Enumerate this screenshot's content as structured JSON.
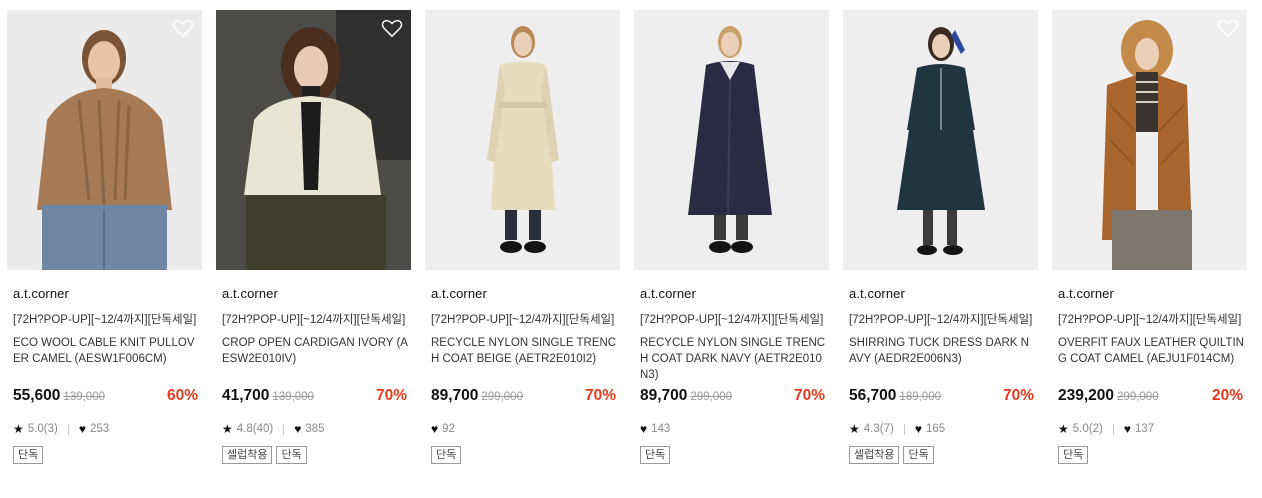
{
  "products": [
    {
      "brand": "a.t.corner",
      "tag": "[72H?POP-UP][~12/4까지][단독세일]",
      "name": "ECO WOOL CABLE KNIT PULLOVER CAMEL (AESW1F006CM)",
      "price": "55,600",
      "original_price": "139,000",
      "discount": "60%",
      "rating": "5.0(3)",
      "likes": "253",
      "badges": [
        "단독"
      ],
      "colors": {
        "bg": "#ededed",
        "main": "#a57a55",
        "bottom": "#6f86a2"
      }
    },
    {
      "brand": "a.t.corner",
      "tag": "[72H?POP-UP][~12/4까지][단독세일]",
      "name": "CROP OPEN CARDIGAN IVORY (AESW2E010IV)",
      "price": "41,700",
      "original_price": "139,000",
      "discount": "70%",
      "rating": "4.8(40)",
      "likes": "385",
      "badges": [
        "셀럽착용",
        "단독"
      ],
      "colors": {
        "bg": "#4a4a48",
        "main": "#e8e5d2",
        "bottom": "#42402e"
      }
    },
    {
      "brand": "a.t.corner",
      "tag": "[72H?POP-UP][~12/4까지][단독세일]",
      "name": "RECYCLE NYLON SINGLE TRENCH COAT BEIGE (AETR2E010I2)",
      "price": "89,700",
      "original_price": "299,000",
      "discount": "70%",
      "rating": "",
      "likes": "92",
      "badges": [
        "단독"
      ],
      "colors": {
        "bg": "#efefef",
        "main": "#e6dcbe",
        "bottom": "#2a2e3a"
      }
    },
    {
      "brand": "a.t.corner",
      "tag": "[72H?POP-UP][~12/4까지][단독세일]",
      "name": "RECYCLE NYLON SINGLE TRENCH COAT DARK NAVY (AETR2E010N3)",
      "price": "89,700",
      "original_price": "299,000",
      "discount": "70%",
      "rating": "",
      "likes": "143",
      "badges": [
        "단독"
      ],
      "colors": {
        "bg": "#efefef",
        "main": "#2a2a44",
        "bottom": "#3a3a3a"
      }
    },
    {
      "brand": "a.t.corner",
      "tag": "[72H?POP-UP][~12/4까지][단독세일]",
      "name": "SHIRRING TUCK DRESS DARK NAVY (AEDR2E006N3)",
      "price": "56,700",
      "original_price": "189,000",
      "discount": "70%",
      "rating": "4.3(7)",
      "likes": "165",
      "badges": [
        "셀럽착용",
        "단독"
      ],
      "colors": {
        "bg": "#efefef",
        "main": "#1f3540",
        "bottom": "#3b3b3b"
      }
    },
    {
      "brand": "a.t.corner",
      "tag": "[72H?POP-UP][~12/4까지][단독세일]",
      "name": "OVERFIT FAUX LEATHER QUILTING COAT CAMEL (AEJU1F014CM)",
      "price": "239,200",
      "original_price": "299,000",
      "discount": "20%",
      "rating": "5.0(2)",
      "likes": "137",
      "badges": [
        "단독"
      ],
      "colors": {
        "bg": "#efefef",
        "main": "#a8652e",
        "bottom": "#7d7770"
      }
    }
  ],
  "colors": {
    "discount": "#e63a1e",
    "strike": "#999999"
  }
}
